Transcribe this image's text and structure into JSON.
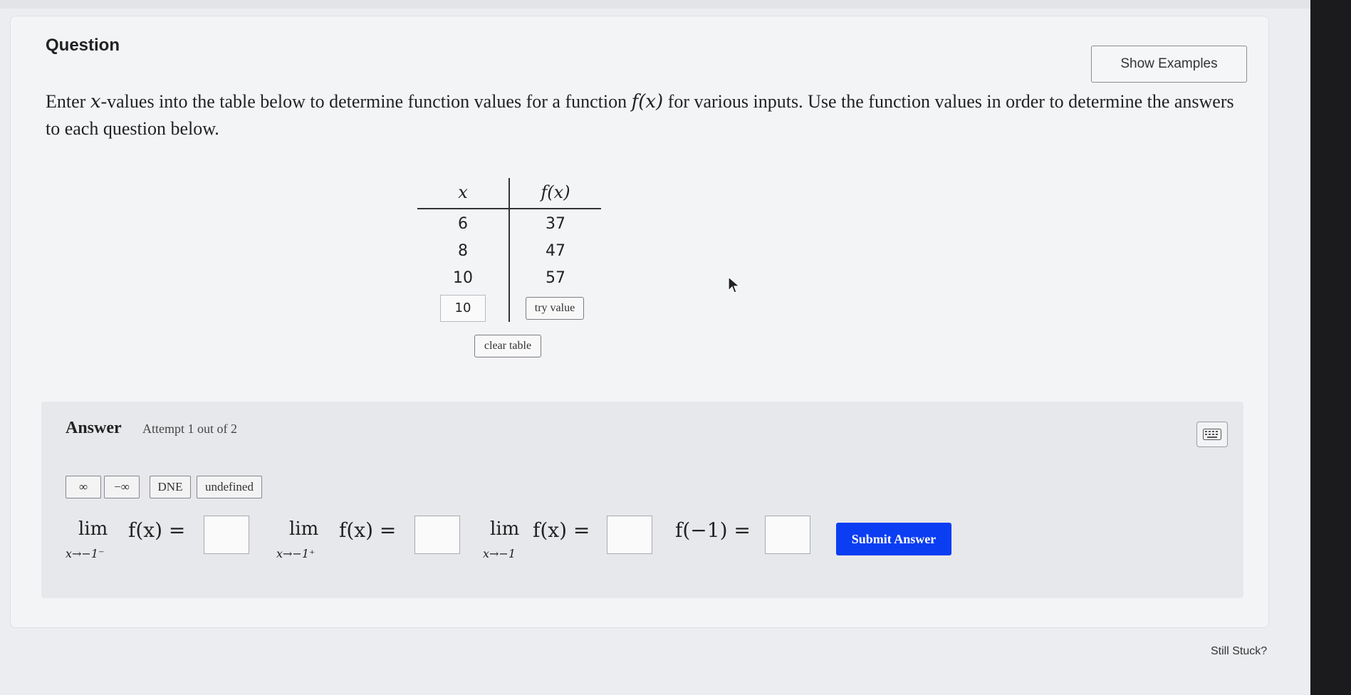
{
  "question": {
    "title": "Question",
    "show_examples_label": "Show Examples",
    "prompt_part1": "Enter ",
    "prompt_var": "x",
    "prompt_part2": "-values into the table below to determine function values for a function ",
    "prompt_func": "f(x)",
    "prompt_part3": " for various inputs. Use the function values in order to determine the answers to each question below."
  },
  "table": {
    "header_x": "x",
    "header_fx": "f(x)",
    "rows": [
      {
        "x": "6",
        "fx": "37"
      },
      {
        "x": "8",
        "fx": "47"
      },
      {
        "x": "10",
        "fx": "57"
      }
    ],
    "input_value": "10",
    "try_value_label": "try value",
    "clear_table_label": "clear table"
  },
  "answer": {
    "label": "Answer",
    "attempt": "Attempt 1 out of 2",
    "keyboard_icon": "keyboard-icon",
    "symbols": [
      "∞",
      "−∞",
      "DNE",
      "undefined"
    ],
    "limits": [
      {
        "lim": "lim",
        "sub": "x→−1⁻",
        "expr": "f(x) ="
      },
      {
        "lim": "lim",
        "sub": "x→−1⁺",
        "expr": "f(x) ="
      },
      {
        "lim": "lim",
        "sub": "x→−1",
        "expr": "f(x) ="
      },
      {
        "lim": "",
        "sub": "",
        "expr": "f(−1) ="
      }
    ],
    "submit_label": "Submit Answer"
  },
  "footer": {
    "still_stuck": "Still Stuck?"
  }
}
